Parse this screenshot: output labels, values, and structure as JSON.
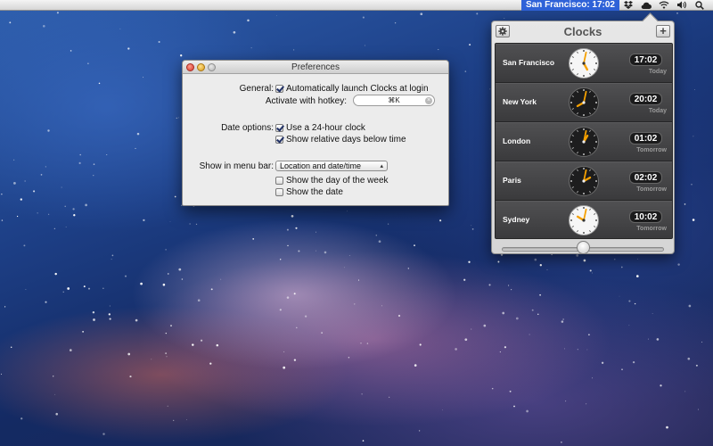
{
  "menubar": {
    "clock_text": "San Francisco: 17:02",
    "icons": [
      "dropbox-icon",
      "cloud-icon",
      "wifi-icon",
      "volume-icon",
      "spotlight-search-icon"
    ]
  },
  "preferences": {
    "title": "Preferences",
    "general_label": "General:",
    "auto_launch_label": "Automatically launch Clocks at login",
    "auto_launch_checked": true,
    "hotkey_label": "Activate with hotkey:",
    "hotkey_value": "⌘K",
    "date_options_label": "Date options:",
    "use_24_label": "Use a 24-hour clock",
    "use_24_checked": true,
    "relative_days_label": "Show relative days below time",
    "relative_days_checked": true,
    "menubar_label": "Show in menu bar:",
    "menubar_select_value": "Location and date/time",
    "day_of_week_label": "Show the day of the week",
    "day_of_week_checked": false,
    "show_date_label": "Show the date",
    "show_date_checked": false
  },
  "clocks": {
    "title": "Clocks",
    "settings_icon": "gear-icon",
    "add_label": "+",
    "slider_value": 0.5,
    "cities": [
      {
        "name": "San Francisco",
        "time": "17:02",
        "day": "Today",
        "theme": "light",
        "hour": 17,
        "minute": 2
      },
      {
        "name": "New York",
        "time": "20:02",
        "day": "Today",
        "theme": "dark",
        "hour": 20,
        "minute": 2
      },
      {
        "name": "London",
        "time": "01:02",
        "day": "Tomorrow",
        "theme": "dark",
        "hour": 1,
        "minute": 2
      },
      {
        "name": "Paris",
        "time": "02:02",
        "day": "Tomorrow",
        "theme": "dark",
        "hour": 2,
        "minute": 2
      },
      {
        "name": "Sydney",
        "time": "10:02",
        "day": "Tomorrow",
        "theme": "light",
        "hour": 10,
        "minute": 2
      }
    ]
  },
  "colors": {
    "menubar_highlight": "#2f62d8",
    "clock_accent": "#f5a000",
    "panel_dark": "#3d3d3f"
  }
}
